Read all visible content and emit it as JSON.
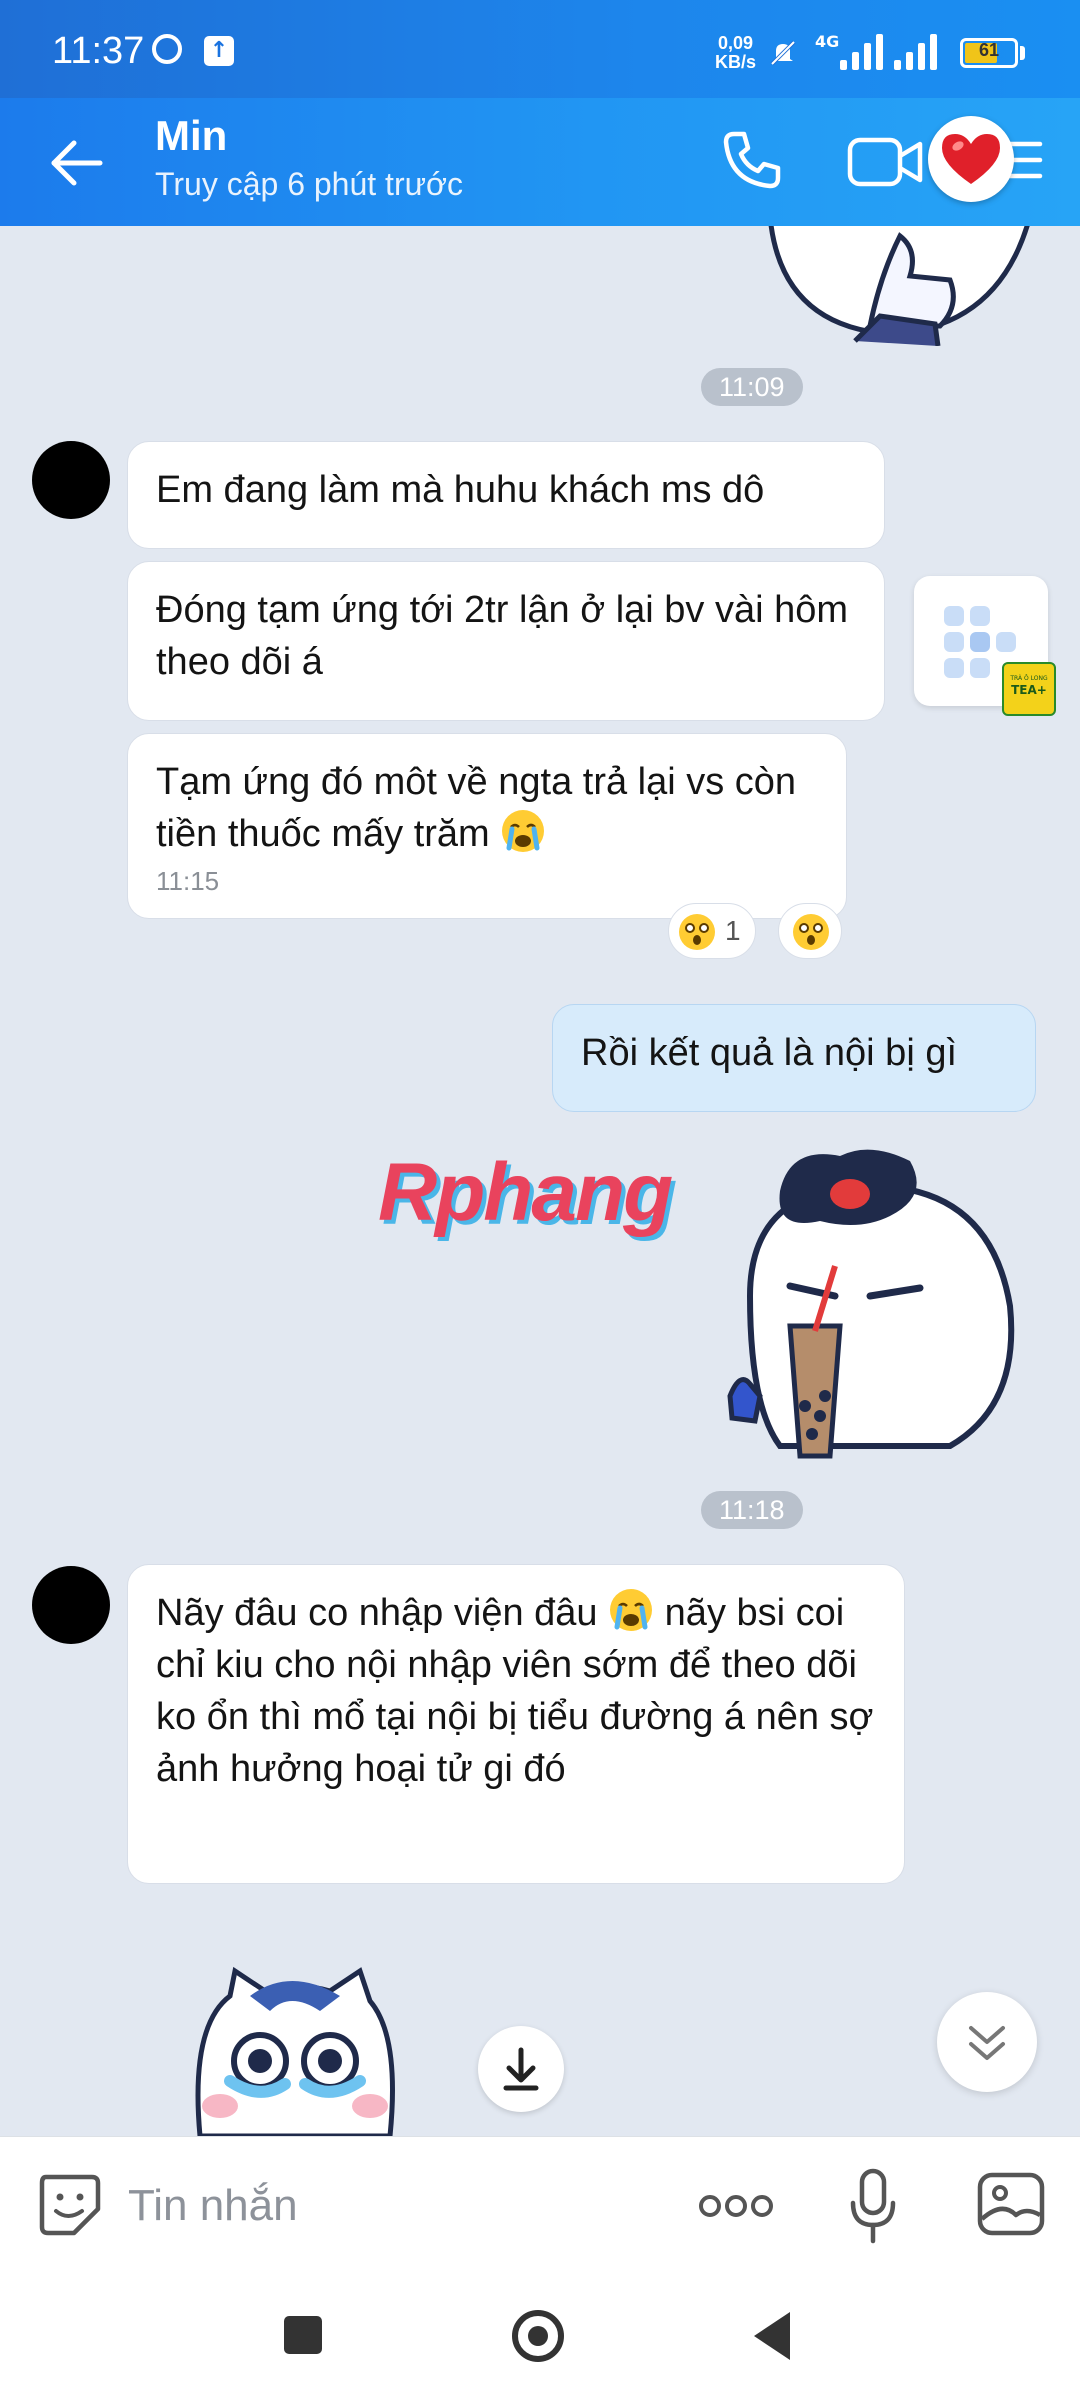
{
  "status_bar": {
    "time": "11:37",
    "net_speed_value": "0,09",
    "net_speed_unit": "KB/s",
    "network": "4G",
    "battery": "61"
  },
  "header": {
    "contact_name": "Min",
    "contact_status": "Truy cập 6 phút trước"
  },
  "chat": {
    "timestamps": [
      "11:09",
      "11:18"
    ],
    "messages": [
      {
        "side": "in",
        "text": "Em đang làm mà huhu khách ms dô"
      },
      {
        "side": "in",
        "text": "Đóng tạm ứng tới 2tr lận ở lại bv vài hôm theo dõi á"
      },
      {
        "side": "in",
        "text": "Tạm ứng đó môt về ngta trả lại vs còn tiền thuốc mấy trăm",
        "time": "11:15",
        "reaction_count": "1"
      },
      {
        "side": "out",
        "text": "Rồi kết quả là nội bị gì"
      },
      {
        "side": "in",
        "text_part1": "Nãy đâu co nhập viện đâu",
        "text_part2": "nãy bsi coi chỉ kiu cho nội nhập viên sớm để theo dõi ko ổn thì mổ tại nội bị tiểu đường á nên sợ ảnh hưởng hoại tử gi đó"
      }
    ],
    "watermark": "Rphang",
    "sticker_brand": "TEA+",
    "sticker_brand_small": "TRÀ Ô LONG"
  },
  "composer": {
    "placeholder": "Tin nhắn"
  },
  "colors": {
    "header_blue": "#1c7bec",
    "outgoing_bubble": "#d7ebfb",
    "chat_background": "#e2e8f1"
  },
  "icons": [
    "back-arrow-icon",
    "phone-icon",
    "video-camera-icon",
    "menu-icon",
    "heart-icon",
    "sticker-icon",
    "more-dots-icon",
    "mic-icon",
    "image-icon",
    "chevron-down-icon",
    "download-icon"
  ]
}
